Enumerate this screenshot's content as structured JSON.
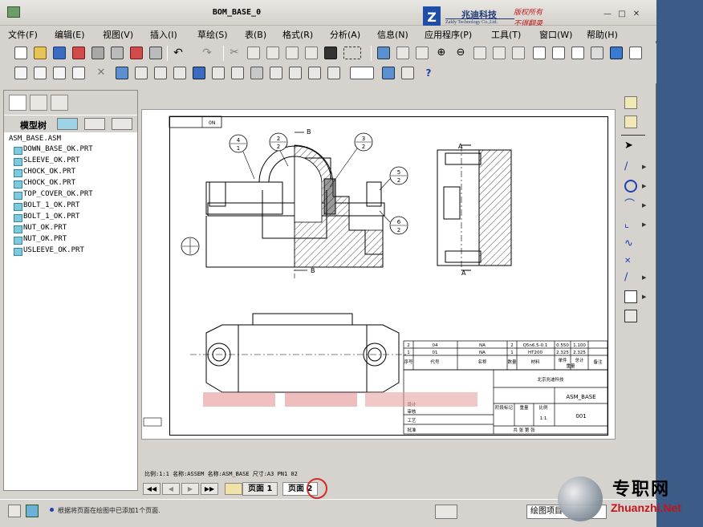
{
  "window": {
    "title": "BOM_BASE_0",
    "logo_text_cn": "兆迪科技",
    "logo_text_en": "Zaldy Technology Co.,Ltd.",
    "copyright_1": "版权所有",
    "copyright_2": "不得翻录"
  },
  "menu": [
    "文件(F)",
    "编辑(E)",
    "视图(V)",
    "插入(I)",
    "草绘(S)",
    "表(B)",
    "格式(R)",
    "分析(A)",
    "信息(N)",
    "应用程序(P)",
    "工具(T)",
    "窗口(W)",
    "帮助(H)"
  ],
  "model_tree": {
    "label": "模型树",
    "root": "ASM_BASE.ASM",
    "items": [
      "DOWN_BASE_OK.PRT",
      "SLEEVE_OK.PRT",
      "CHOCK_OK.PRT",
      "CHOCK_OK.PRT",
      "TOP_COVER_OK.PRT",
      "BOLT_1_OK.PRT",
      "BOLT_1_OK.PRT",
      "NUT_OK.PRT",
      "NUT_OK.PRT",
      "USLEEVE_OK.PRT"
    ]
  },
  "drawing": {
    "corner_label": "0N",
    "balloons": [
      {
        "top": "4",
        "bottom": "1"
      },
      {
        "top": "2",
        "bottom": "2"
      },
      {
        "top": "3",
        "bottom": "2"
      },
      {
        "top": "5",
        "bottom": "2"
      },
      {
        "top": "6",
        "bottom": "2"
      }
    ],
    "section_letters": [
      "B",
      "B",
      "A",
      "A"
    ],
    "bom_rows": [
      [
        "2",
        "04",
        "NA",
        "2",
        "Q5n6.5-0.1",
        "0.550",
        "1.100"
      ],
      [
        "1",
        "01",
        "NA",
        "1",
        "HT200",
        "2.325",
        "2.325"
      ]
    ],
    "bom_header": [
      "序号",
      "代号",
      "名称",
      "数量",
      "材料",
      "单件",
      "总计"
    ],
    "bom_header_extra": [
      "重量",
      "备注"
    ],
    "title_block": {
      "company": "北京兆迪科技",
      "part_name": "ASM_BASE",
      "drawing_no": "001",
      "scale_label": "比例",
      "scale": "1:1",
      "stage_label": "阶段标记",
      "weight_label": "重量",
      "sheet_info": "共 张 第 张"
    },
    "title_block_labels": [
      "设计",
      "审核",
      "工艺",
      "批准"
    ],
    "footer": "比例:1:1   名称:ASSEM   名称:ASM_BASE   尺寸:A3   PN1 02"
  },
  "pages": {
    "tab1": "页面 1",
    "tab2": "页面 2"
  },
  "status": {
    "message": "根据将页面在绘图中已添加1个页面.",
    "mode": "绘图项目"
  },
  "watermark": {
    "cn": "专职网",
    "en": "Zhuanzhi.Net"
  }
}
